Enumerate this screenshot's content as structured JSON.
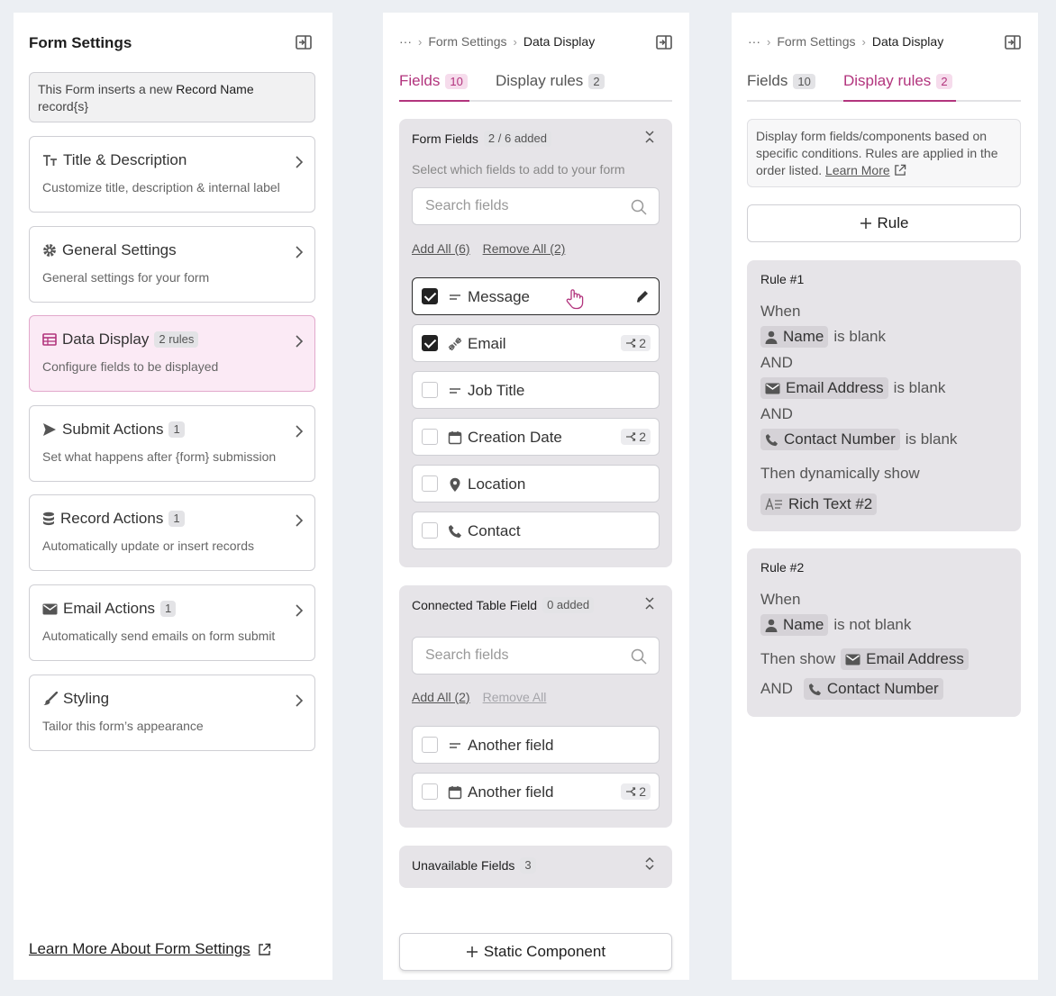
{
  "panel1": {
    "title": "Form Settings",
    "info": {
      "prefix": "This Form inserts a new",
      "bold": "Record Name",
      "suffix": "record{s}"
    },
    "cards": [
      {
        "title": "Title & Description",
        "badge": "",
        "desc": "Customize title, description & internal label",
        "icon": "text-format-icon"
      },
      {
        "title": "General Settings",
        "badge": "",
        "desc": "General settings for your form",
        "icon": "gear-icon"
      },
      {
        "title": "Data Display",
        "badge": "2 rules",
        "desc": "Configure fields to be displayed",
        "icon": "table-icon"
      },
      {
        "title": "Submit Actions",
        "badge": "1",
        "desc": "Set what happens after {form} submission",
        "icon": "send-icon"
      },
      {
        "title": "Record Actions",
        "badge": "1",
        "desc": "Automatically update or insert records",
        "icon": "database-icon"
      },
      {
        "title": "Email Actions",
        "badge": "1",
        "desc": "Automatically send emails on form submit",
        "icon": "envelope-icon"
      },
      {
        "title": "Styling",
        "badge": "",
        "desc": "Tailor this form’s appearance",
        "icon": "brush-icon"
      }
    ],
    "learn_more": "Learn More About Form Settings"
  },
  "breadcrumbs": {
    "ellipsis": "···",
    "parent": "Form Settings",
    "current": "Data Display"
  },
  "tabs": {
    "fields_label": "Fields",
    "fields_count": "10",
    "rules_label": "Display rules",
    "rules_count": "2"
  },
  "panel2": {
    "form_fields": {
      "title": "Form Fields",
      "count": "2 / 6 added",
      "hint": "Select which fields to add to your form",
      "search_placeholder": "Search fields",
      "add_all": "Add All (6)",
      "remove_all": "Remove All (2)",
      "fields": [
        {
          "name": "Message",
          "checked": true,
          "icon": "text-lines-icon",
          "dep": ""
        },
        {
          "name": "Email",
          "checked": true,
          "icon": "link-plug-icon",
          "dep": "2"
        },
        {
          "name": "Job Title",
          "checked": false,
          "icon": "text-lines-icon",
          "dep": ""
        },
        {
          "name": "Creation Date",
          "checked": false,
          "icon": "calendar-icon",
          "dep": "2"
        },
        {
          "name": "Location",
          "checked": false,
          "icon": "pin-icon",
          "dep": ""
        },
        {
          "name": "Contact",
          "checked": false,
          "icon": "phone-icon",
          "dep": ""
        }
      ]
    },
    "connected": {
      "title": "Connected Table Field",
      "count": "0 added",
      "search_placeholder": "Search fields",
      "add_all": "Add All (2)",
      "remove_all": "Remove All",
      "fields": [
        {
          "name": "Another field",
          "checked": false,
          "icon": "text-lines-icon",
          "dep": ""
        },
        {
          "name": "Another field",
          "checked": false,
          "icon": "calendar-icon",
          "dep": "2"
        }
      ]
    },
    "unavailable": {
      "title": "Unavailable Fields",
      "count": "3"
    },
    "static_button": "Static Component"
  },
  "panel3": {
    "description": "Display form fields/components based on specific conditions. Rules are applied in the order listed.",
    "learn_more": "Learn More",
    "rule_button": "Rule",
    "rules": [
      {
        "title": "Rule #1",
        "when": "When",
        "conditions": [
          {
            "field": "Name",
            "op": "is blank"
          },
          {
            "field": "Email Address",
            "op": "is blank"
          },
          {
            "field": "Contact Number",
            "op": "is blank"
          }
        ],
        "and": "AND",
        "then": "Then dynamically show",
        "show": "Rich Text #2"
      },
      {
        "title": "Rule #2",
        "when": "When",
        "conditions": [
          {
            "field": "Name",
            "op": "is not blank"
          }
        ],
        "then": "Then show",
        "show": [
          "Email Address",
          "Contact Number"
        ],
        "and": "AND"
      }
    ]
  },
  "colors": {
    "accent": "#b2347d",
    "active_card_bg": "#fbeaf5",
    "group_bg": "#e6e4e8"
  }
}
